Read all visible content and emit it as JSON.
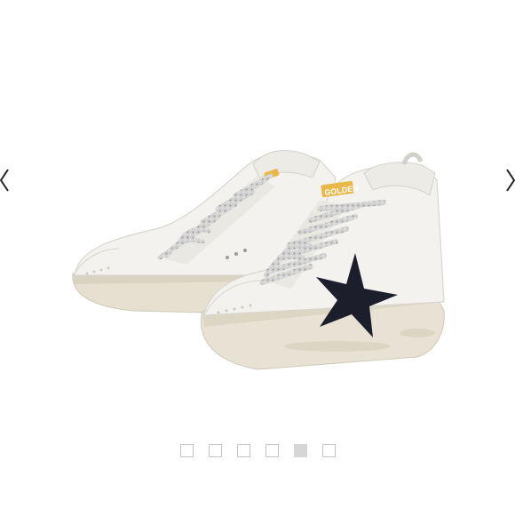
{
  "carousel": {
    "prev_icon": "chevron-left-icon",
    "next_icon": "chevron-right-icon",
    "slide_count": 6,
    "active_index": 4
  },
  "product_image": {
    "logo_text": "GOLDEN",
    "colors": {
      "leather": "#f3f2ee",
      "sole": "#e7e2d3",
      "star": "#1c1f2b",
      "laces": "#c9c9c9",
      "tab": "#e8b94a"
    }
  }
}
